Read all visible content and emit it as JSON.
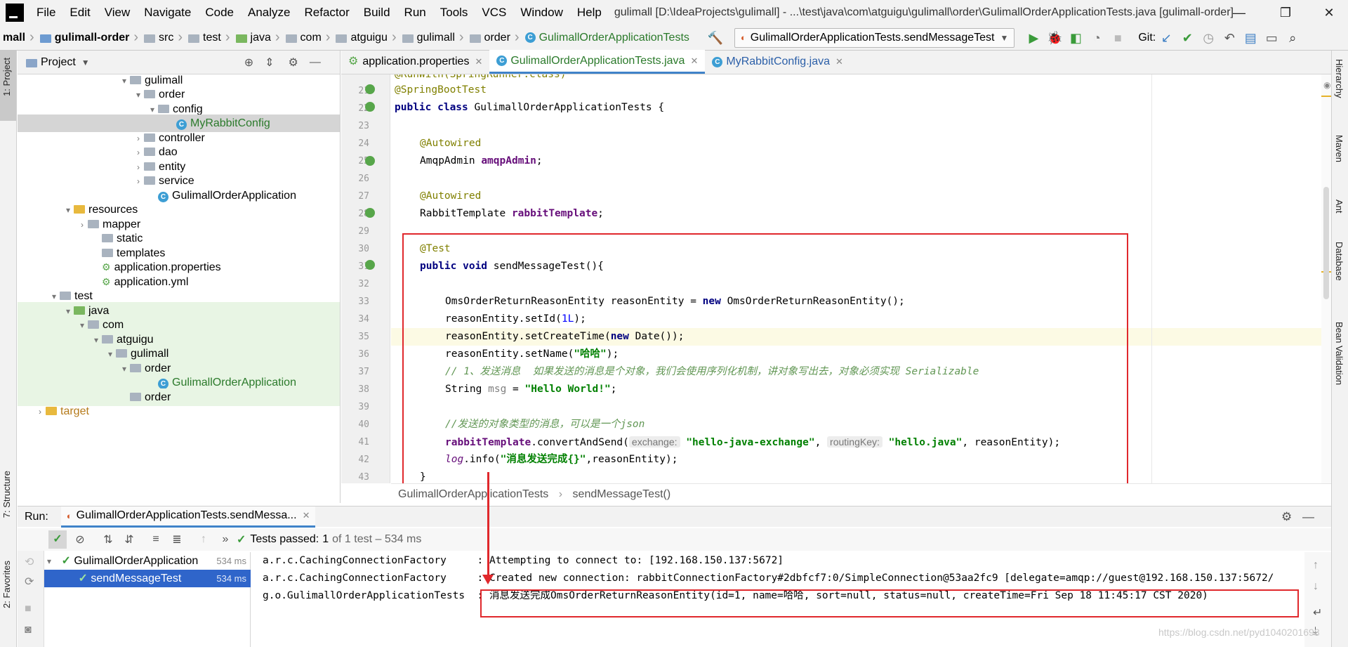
{
  "titlebar": {
    "menus": [
      "File",
      "Edit",
      "View",
      "Navigate",
      "Code",
      "Analyze",
      "Refactor",
      "Build",
      "Run",
      "Tools",
      "VCS",
      "Window",
      "Help"
    ],
    "title": "gulimall [D:\\IdeaProjects\\gulimall] - ...\\test\\java\\com\\atguigu\\gulimall\\order\\GulimallOrderApplicationTests.java [gulimall-order]"
  },
  "navbar": {
    "crumbs": [
      "mall",
      "gulimall-order",
      "src",
      "test",
      "java",
      "com",
      "atguigu",
      "gulimall",
      "order",
      "GulimallOrderApplicationTests"
    ],
    "run_config": "GulimallOrderApplicationTests.sendMessageTest",
    "git_label": "Git:"
  },
  "left_strip": {
    "project_tab": "1: Project",
    "structure_tab": "7: Structure",
    "favorites_tab": "2: Favorites"
  },
  "right_strip": {
    "hierarchy": "Hierarchy",
    "maven": "Maven",
    "ant": "Ant",
    "database": "Database",
    "bean_validation": "Bean Validation"
  },
  "project": {
    "title": "Project",
    "tree": [
      {
        "label": "gulimall",
        "arrow": "▾",
        "icon": "folder"
      },
      {
        "label": "order",
        "arrow": "▾",
        "icon": "folder"
      },
      {
        "label": "config",
        "arrow": "▾",
        "icon": "folder"
      },
      {
        "label": "MyRabbitConfig",
        "arrow": "",
        "icon": "class"
      },
      {
        "label": "controller",
        "arrow": "›",
        "icon": "folder"
      },
      {
        "label": "dao",
        "arrow": "›",
        "icon": "folder"
      },
      {
        "label": "entity",
        "arrow": "›",
        "icon": "folder"
      },
      {
        "label": "service",
        "arrow": "›",
        "icon": "folder"
      },
      {
        "label": "GulimallOrderApplication",
        "arrow": "",
        "icon": "class"
      },
      {
        "label": "resources",
        "arrow": "▾",
        "icon": "folder"
      },
      {
        "label": "mapper",
        "arrow": "›",
        "icon": "folder"
      },
      {
        "label": "static",
        "arrow": "",
        "icon": "folder"
      },
      {
        "label": "templates",
        "arrow": "",
        "icon": "folder"
      },
      {
        "label": "application.properties",
        "arrow": "",
        "icon": "props"
      },
      {
        "label": "application.yml",
        "arrow": "",
        "icon": "props"
      },
      {
        "label": "test",
        "arrow": "▾",
        "icon": "folder"
      },
      {
        "label": "java",
        "arrow": "▾",
        "icon": "folder"
      },
      {
        "label": "com",
        "arrow": "▾",
        "icon": "folder"
      },
      {
        "label": "atguigu",
        "arrow": "▾",
        "icon": "folder"
      },
      {
        "label": "gulimall",
        "arrow": "▾",
        "icon": "folder"
      },
      {
        "label": "order",
        "arrow": "▾",
        "icon": "folder"
      },
      {
        "label": "GulimallOrderApplication",
        "arrow": "",
        "icon": "class"
      },
      {
        "label": "order",
        "arrow": "",
        "icon": "folder"
      },
      {
        "label": "target",
        "arrow": "›",
        "icon": "folder"
      }
    ]
  },
  "editor": {
    "tabs": [
      "application.properties",
      "GulimallOrderApplicationTests.java",
      "MyRabbitConfig.java"
    ],
    "line_numbers": [
      "21",
      "22",
      "23",
      "24",
      "25",
      "26",
      "27",
      "28",
      "29",
      "30",
      "31",
      "32",
      "33",
      "34",
      "35",
      "36",
      "37",
      "38",
      "39",
      "40",
      "41",
      "42",
      "43"
    ],
    "code": {
      "l20": "@RunWith(SpringRunner.class)",
      "l21": "@SpringBootTest",
      "l22_kw": "public class ",
      "l22_name": "GulimallOrderApplicationTests {",
      "l24": "@Autowired",
      "l25_type": "AmqpAdmin ",
      "l25_field": "amqpAdmin",
      "l27": "@Autowired",
      "l28_type": "RabbitTemplate ",
      "l28_field": "rabbitTemplate",
      "l30": "@Test",
      "l31_kw": "public void ",
      "l31_rest": "sendMessageTest(){",
      "l33_a": "OmsOrderReturnReasonEntity reasonEntity = ",
      "l33_kw": "new ",
      "l33_b": "OmsOrderReturnReasonEntity();",
      "l34_a": "reasonEntity.setId(",
      "l34_num": "1L",
      "l34_b": ");",
      "l35_a": "reasonEntity.setCreateTime(",
      "l35_kw": "new ",
      "l35_b": "Date());",
      "l36_a": "reasonEntity.setName(",
      "l36_str": "\"哈哈\"",
      "l36_b": ");",
      "l37_cmt": "// 1、发送消息  如果发送的消息是个对象，我们会使用序列化机制，讲对象写出去，对象必须实现 ",
      "l37_ser": "Serializable",
      "l38_a": "String ",
      "l38_var": "msg",
      "l38_b": " = ",
      "l38_str": "\"Hello World!\"",
      "l40_cmt": "//发送的对象类型的消息，可以是一个",
      "l40_json": "json",
      "l41_field": "rabbitTemplate",
      "l41_a": ".convertAndSend(",
      "l41_hint1": "exchange:",
      "l41_str1": "\"hello-java-exchange\"",
      "l41_hint2": "routingKey:",
      "l41_str2": "\"hello.java\"",
      "l41_b": ", reasonEntity);",
      "l42_log": "log",
      "l42_a": ".info(",
      "l42_str": "\"消息发送完成{}\"",
      "l42_b": ",reasonEntity);",
      "l43": "}",
      "comma": ", ",
      "semicolon": ";"
    },
    "breadcrumb_class": "GulimallOrderApplicationTests",
    "breadcrumb_method": "sendMessageTest()"
  },
  "run": {
    "label": "Run:",
    "tab": "GulimallOrderApplicationTests.sendMessa...",
    "tests_passed": "Tests passed:",
    "tests_count": "1",
    "tests_rest": "of 1 test – 534 ms",
    "tree": [
      {
        "label": "GulimallOrderApplication",
        "time": "534 ms"
      },
      {
        "label": "sendMessageTest",
        "time": "534 ms"
      }
    ],
    "console": [
      {
        "source": "a.r.c.CachingConnectionFactory     ",
        "msg": ": Attempting to connect to: [192.168.150.137:5672]"
      },
      {
        "source": "a.r.c.CachingConnectionFactory     ",
        "msg": ": Created new connection: rabbitConnectionFactory#2dbfcf7:0/SimpleConnection@53aa2fc9 [delegate=amqp://guest@192.168.150.137:5672/"
      },
      {
        "source": "g.o.GulimallOrderApplicationTests  ",
        "msg": ": 消息发送完成OmsOrderReturnReasonEntity(id=1, name=哈哈, sort=null, status=null, createTime=Fri Sep 18 11:45:17 CST 2020)"
      }
    ]
  },
  "watermark": "https://blog.csdn.net/pyd1040201698"
}
